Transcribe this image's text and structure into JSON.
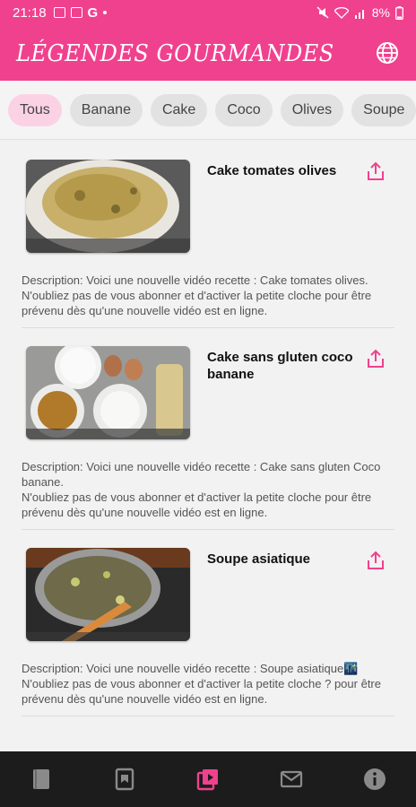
{
  "status_bar": {
    "time": "21:18",
    "battery": "8%",
    "g_label": "G"
  },
  "app": {
    "title": "LÉGENDES GOURMANDES"
  },
  "colors": {
    "primary": "#f0418e",
    "chip_active": "#fbd2e4",
    "nav_bg": "#1c1c1c"
  },
  "chips": [
    "Tous",
    "Banane",
    "Cake",
    "Coco",
    "Olives",
    "Soupe"
  ],
  "videos": [
    {
      "title": "Cake tomates olives",
      "description": "Description: Voici une nouvelle vidéo recette : Cake tomates olives. N'oubliez pas de vous abonner et d'activer la petite cloche pour être prévenu dès qu'une nouvelle vidéo est en ligne."
    },
    {
      "title": "Cake sans gluten coco banane",
      "description_line1": "Description: Voici une nouvelle vidéo recette : Cake sans gluten Coco banane.",
      "description_line2": "N'oubliez pas de vous abonner et d'activer la petite cloche pour être prévenu dès qu'une nouvelle vidéo est en ligne."
    },
    {
      "title": "Soupe asiatique",
      "description_line1": "Description: Voici une nouvelle vidéo recette : Soupe asiatique🌃",
      "description_line2": "N'oubliez pas de vous abonner et d'activer la petite cloche ? pour être prévenu dès qu'une nouvelle vidéo est en ligne."
    }
  ],
  "bottom_nav": [
    "book-icon",
    "bookmark-icon",
    "video-icon",
    "mail-icon",
    "info-icon"
  ]
}
